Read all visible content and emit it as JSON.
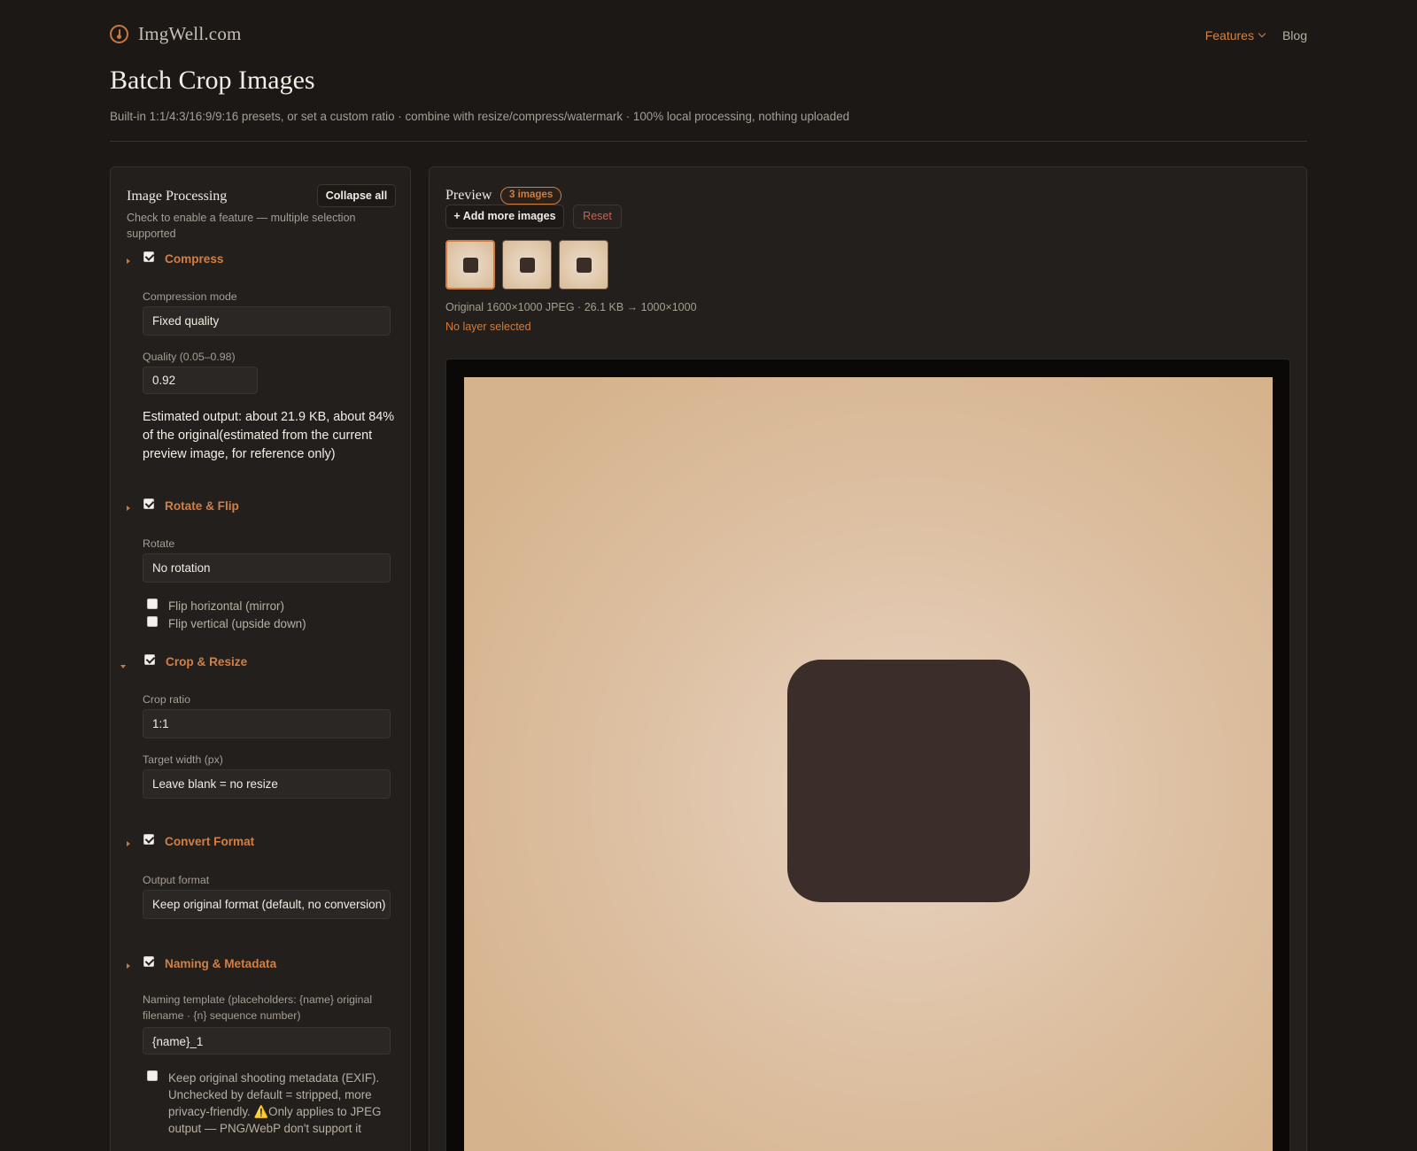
{
  "header": {
    "logo_text": "ImgWell.com",
    "nav_features": "Features",
    "nav_blog": "Blog"
  },
  "page": {
    "title": "Batch Crop Images",
    "subtitle": "Built-in 1:1/4:3/16:9/9:16 presets, or set a custom ratio · combine with resize/compress/watermark · 100% local processing, nothing uploaded"
  },
  "sidebar": {
    "title": "Image Processing",
    "collapse_label": "Collapse all",
    "hint": "Check to enable a feature — multiple selection supported",
    "compress": {
      "title": "Compress",
      "enabled": true,
      "mode_label": "Compression mode",
      "mode_value": "Fixed quality",
      "quality_label": "Quality (0.05–0.98)",
      "quality_value": "0.92",
      "estimate": "Estimated output: about 21.9 KB, about 84% of the original(estimated from the current preview image, for reference only)"
    },
    "rotate": {
      "title": "Rotate & Flip",
      "enabled": true,
      "rotate_label": "Rotate",
      "rotate_value": "No rotation",
      "flip_h": "Flip horizontal (mirror)",
      "flip_v": "Flip vertical (upside down)"
    },
    "crop": {
      "title": "Crop & Resize",
      "enabled": true,
      "ratio_label": "Crop ratio",
      "ratio_value": "1:1",
      "width_label": "Target width (px)",
      "width_placeholder": "Leave blank = no resize"
    },
    "convert": {
      "title": "Convert Format",
      "enabled": true,
      "format_label": "Output format",
      "format_value": "Keep original format (default, no conversion)"
    },
    "naming": {
      "title": "Naming & Metadata",
      "enabled": true,
      "template_label": "Naming template (placeholders: {name} original filename · {n} sequence number)",
      "template_value": "{name}_1",
      "exif_label": "Keep original shooting metadata (EXIF). Unchecked by default = stripped, more privacy-friendly. ⚠️Only applies to JPEG output — PNG/WebP don't support it"
    }
  },
  "preview": {
    "title": "Preview",
    "badge": "3 images",
    "add_label": "+ Add more images",
    "reset_label": "Reset",
    "info": "Original 1600×1000 JPEG · 26.1 KB → 1000×1000",
    "layer_status": "No layer selected",
    "thumbnail_count": 3,
    "selected_thumbnail": 1
  },
  "colors": {
    "accent": "#d07c40",
    "background": "#1b1816",
    "panel": "#221f1c",
    "danger": "#d0604a"
  }
}
